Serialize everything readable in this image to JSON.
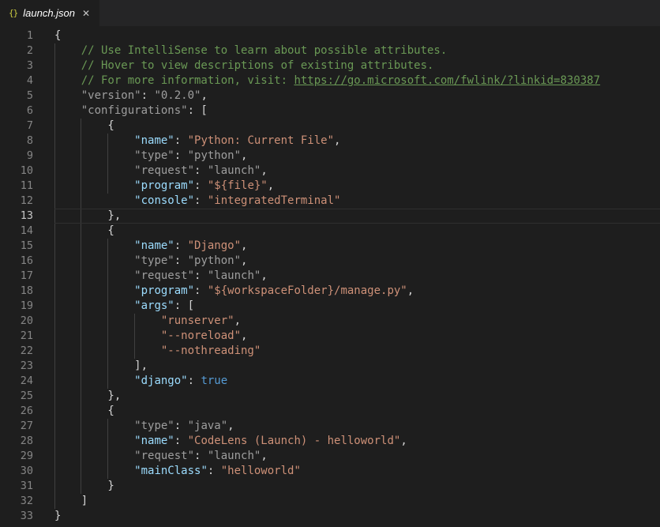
{
  "tab": {
    "icon": "{}",
    "filename": "launch.json",
    "close": "✕"
  },
  "lines": [
    {
      "num": "1",
      "segs": [
        {
          "t": "{",
          "c": "p"
        }
      ]
    },
    {
      "num": "2",
      "segs": [
        {
          "t": "    // Use IntelliSense to learn about possible attributes.",
          "c": "c"
        }
      ]
    },
    {
      "num": "3",
      "segs": [
        {
          "t": "    // Hover to view descriptions of existing attributes.",
          "c": "c"
        }
      ]
    },
    {
      "num": "4",
      "segs": [
        {
          "t": "    // For more information, visit: ",
          "c": "c"
        },
        {
          "t": "https://go.microsoft.com/fwlink/?linkid=830387",
          "c": "c u"
        }
      ]
    },
    {
      "num": "5",
      "segs": [
        {
          "t": "    ",
          "c": "p"
        },
        {
          "t": "\"version\"",
          "c": "kd"
        },
        {
          "t": ": ",
          "c": "p"
        },
        {
          "t": "\"0.2.0\"",
          "c": "kd"
        },
        {
          "t": ",",
          "c": "p"
        }
      ]
    },
    {
      "num": "6",
      "segs": [
        {
          "t": "    ",
          "c": "p"
        },
        {
          "t": "\"configurations\"",
          "c": "kd"
        },
        {
          "t": ": [",
          "c": "p"
        }
      ]
    },
    {
      "num": "7",
      "segs": [
        {
          "t": "        {",
          "c": "p"
        }
      ]
    },
    {
      "num": "8",
      "segs": [
        {
          "t": "            ",
          "c": "p"
        },
        {
          "t": "\"name\"",
          "c": "k"
        },
        {
          "t": ": ",
          "c": "p"
        },
        {
          "t": "\"Python: Current File\"",
          "c": "s"
        },
        {
          "t": ",",
          "c": "p"
        }
      ]
    },
    {
      "num": "9",
      "segs": [
        {
          "t": "            ",
          "c": "p"
        },
        {
          "t": "\"type\"",
          "c": "kd"
        },
        {
          "t": ": ",
          "c": "p"
        },
        {
          "t": "\"python\"",
          "c": "kd"
        },
        {
          "t": ",",
          "c": "p"
        }
      ]
    },
    {
      "num": "10",
      "segs": [
        {
          "t": "            ",
          "c": "p"
        },
        {
          "t": "\"request\"",
          "c": "kd"
        },
        {
          "t": ": ",
          "c": "p"
        },
        {
          "t": "\"launch\"",
          "c": "kd"
        },
        {
          "t": ",",
          "c": "p"
        }
      ]
    },
    {
      "num": "11",
      "segs": [
        {
          "t": "            ",
          "c": "p"
        },
        {
          "t": "\"program\"",
          "c": "k"
        },
        {
          "t": ": ",
          "c": "p"
        },
        {
          "t": "\"${file}\"",
          "c": "s"
        },
        {
          "t": ",",
          "c": "p"
        }
      ]
    },
    {
      "num": "12",
      "segs": [
        {
          "t": "            ",
          "c": "p"
        },
        {
          "t": "\"console\"",
          "c": "k"
        },
        {
          "t": ": ",
          "c": "p"
        },
        {
          "t": "\"integratedTerminal\"",
          "c": "s"
        }
      ]
    },
    {
      "num": "13",
      "current": true,
      "segs": [
        {
          "t": "        },",
          "c": "p"
        }
      ]
    },
    {
      "num": "14",
      "segs": [
        {
          "t": "        {",
          "c": "p"
        }
      ]
    },
    {
      "num": "15",
      "segs": [
        {
          "t": "            ",
          "c": "p"
        },
        {
          "t": "\"name\"",
          "c": "k"
        },
        {
          "t": ": ",
          "c": "p"
        },
        {
          "t": "\"Django\"",
          "c": "s"
        },
        {
          "t": ",",
          "c": "p"
        }
      ]
    },
    {
      "num": "16",
      "segs": [
        {
          "t": "            ",
          "c": "p"
        },
        {
          "t": "\"type\"",
          "c": "kd"
        },
        {
          "t": ": ",
          "c": "p"
        },
        {
          "t": "\"python\"",
          "c": "kd"
        },
        {
          "t": ",",
          "c": "p"
        }
      ]
    },
    {
      "num": "17",
      "segs": [
        {
          "t": "            ",
          "c": "p"
        },
        {
          "t": "\"request\"",
          "c": "kd"
        },
        {
          "t": ": ",
          "c": "p"
        },
        {
          "t": "\"launch\"",
          "c": "kd"
        },
        {
          "t": ",",
          "c": "p"
        }
      ]
    },
    {
      "num": "18",
      "segs": [
        {
          "t": "            ",
          "c": "p"
        },
        {
          "t": "\"program\"",
          "c": "k"
        },
        {
          "t": ": ",
          "c": "p"
        },
        {
          "t": "\"${workspaceFolder}/manage.py\"",
          "c": "s"
        },
        {
          "t": ",",
          "c": "p"
        }
      ]
    },
    {
      "num": "19",
      "segs": [
        {
          "t": "            ",
          "c": "p"
        },
        {
          "t": "\"args\"",
          "c": "k"
        },
        {
          "t": ": [",
          "c": "p"
        }
      ]
    },
    {
      "num": "20",
      "segs": [
        {
          "t": "                ",
          "c": "p"
        },
        {
          "t": "\"runserver\"",
          "c": "s"
        },
        {
          "t": ",",
          "c": "p"
        }
      ]
    },
    {
      "num": "21",
      "segs": [
        {
          "t": "                ",
          "c": "p"
        },
        {
          "t": "\"--noreload\"",
          "c": "s"
        },
        {
          "t": ",",
          "c": "p"
        }
      ]
    },
    {
      "num": "22",
      "segs": [
        {
          "t": "                ",
          "c": "p"
        },
        {
          "t": "\"--nothreading\"",
          "c": "s"
        }
      ]
    },
    {
      "num": "23",
      "segs": [
        {
          "t": "            ],",
          "c": "p"
        }
      ]
    },
    {
      "num": "24",
      "segs": [
        {
          "t": "            ",
          "c": "p"
        },
        {
          "t": "\"django\"",
          "c": "k"
        },
        {
          "t": ": ",
          "c": "p"
        },
        {
          "t": "true",
          "c": "b"
        }
      ]
    },
    {
      "num": "25",
      "segs": [
        {
          "t": "        },",
          "c": "p"
        }
      ]
    },
    {
      "num": "26",
      "segs": [
        {
          "t": "        {",
          "c": "p"
        }
      ]
    },
    {
      "num": "27",
      "segs": [
        {
          "t": "            ",
          "c": "p"
        },
        {
          "t": "\"type\"",
          "c": "kd"
        },
        {
          "t": ": ",
          "c": "p"
        },
        {
          "t": "\"java\"",
          "c": "kd"
        },
        {
          "t": ",",
          "c": "p"
        }
      ]
    },
    {
      "num": "28",
      "segs": [
        {
          "t": "            ",
          "c": "p"
        },
        {
          "t": "\"name\"",
          "c": "k"
        },
        {
          "t": ": ",
          "c": "p"
        },
        {
          "t": "\"CodeLens (Launch) - helloworld\"",
          "c": "s"
        },
        {
          "t": ",",
          "c": "p"
        }
      ]
    },
    {
      "num": "29",
      "segs": [
        {
          "t": "            ",
          "c": "p"
        },
        {
          "t": "\"request\"",
          "c": "kd"
        },
        {
          "t": ": ",
          "c": "p"
        },
        {
          "t": "\"launch\"",
          "c": "kd"
        },
        {
          "t": ",",
          "c": "p"
        }
      ]
    },
    {
      "num": "30",
      "segs": [
        {
          "t": "            ",
          "c": "p"
        },
        {
          "t": "\"mainClass\"",
          "c": "k"
        },
        {
          "t": ": ",
          "c": "p"
        },
        {
          "t": "\"helloworld\"",
          "c": "s"
        }
      ]
    },
    {
      "num": "31",
      "segs": [
        {
          "t": "        }",
          "c": "p"
        }
      ]
    },
    {
      "num": "32",
      "segs": [
        {
          "t": "    ]",
          "c": "p"
        }
      ]
    },
    {
      "num": "33",
      "segs": [
        {
          "t": "}",
          "c": "p"
        }
      ]
    }
  ]
}
